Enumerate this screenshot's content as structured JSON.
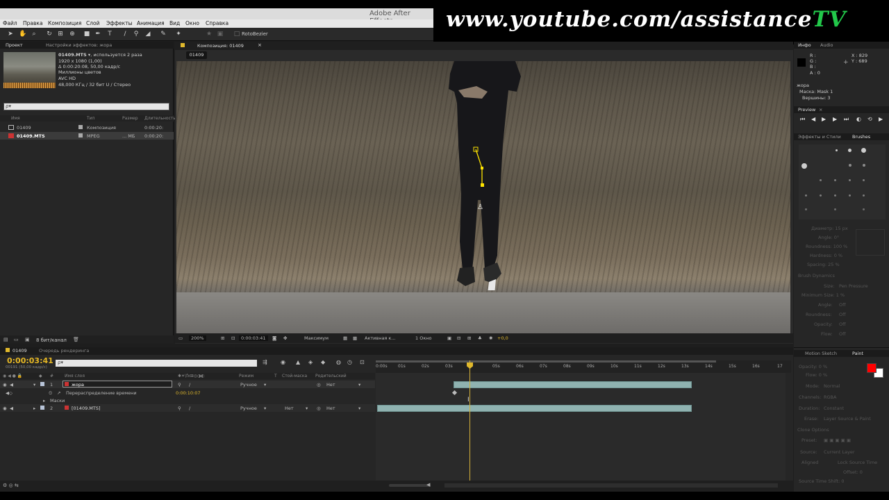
{
  "window": {
    "title": "Adobe After Effects -"
  },
  "banner": {
    "url_main": "www.youtube.com/assistance",
    "url_tv": "TV"
  },
  "menu": [
    "Файл",
    "Правка",
    "Композиция",
    "Слой",
    "Эффекты",
    "Анимация",
    "Вид",
    "Окно",
    "Справка"
  ],
  "toolbar": {
    "rotobezier_label": "RotoBezier"
  },
  "project": {
    "tab_project": "Проект",
    "tab_effects": "Настройки эффектов: жора",
    "footage_name": "01409.MTS ▾",
    "footage_used": ", используется 2 раза",
    "footage_res": "1920 x 1080 (1,00)",
    "footage_dur": "Δ 0:00:20:08, 50,00 кадр/с",
    "footage_colors": "Миллионы цветов",
    "footage_codec": "AVC HD",
    "footage_audio": "48,000 КГц / 32 бит U / Стерео",
    "search_placeholder": "ρ▾",
    "col_name": "Имя",
    "col_type": "Тип",
    "col_size": "Размер",
    "col_duration": "Длительность",
    "items": [
      {
        "name": "01409",
        "type": "Композиция",
        "size": "",
        "duration": "0:00:20:"
      },
      {
        "name": "01409.MTS",
        "type": "MPEG",
        "size": "... МБ",
        "duration": "0:00:20:"
      }
    ],
    "footer_bits": "8 бит/канал"
  },
  "composition": {
    "tab": "Композиция: 01409",
    "breadcrumb": "01409",
    "zoom": "200%",
    "timecode": "0:00:03:41",
    "quality": "Максимум",
    "camera": "Активная к...",
    "views": "1 Окно",
    "exposure": "+0,0"
  },
  "info_panel": {
    "tab_info": "Инфо",
    "tab_audio": "Audio",
    "r": "R :",
    "g": "G :",
    "b": "B :",
    "a": "A : 0",
    "x": "X : 829",
    "y": "Y : 689",
    "layer": "жора",
    "mask": "Маска: Mask 1",
    "vertices": "Вершины: 3"
  },
  "preview_panel": {
    "tab": "Preview"
  },
  "effects_panel": {
    "tab_effects": "Эффекты и Стили",
    "tab_brushes": "Brushes",
    "diameter": "Диаметр: 15 px",
    "angle": "Angle: 0°",
    "roundness": "Roundness: 100 %",
    "hardness": "Hardness: 0 %",
    "spacing": "Spacing: 25 %",
    "dynamics": "Brush Dynamics",
    "size": "Size:",
    "size_val": "Pen Pressure",
    "min_size": "Minimum Size: 1 %",
    "angle2": "Angle:",
    "angle2_val": "Off",
    "roundness2": "Roundness:",
    "roundness2_val": "Off",
    "opacity": "Opacity:",
    "opacity_val": "Off",
    "flow": "Flow:",
    "flow_val": "Off"
  },
  "paint_panel": {
    "tab_motion": "Motion Sketch",
    "tab_paint": "Paint",
    "opacity": "Opacity: 0 %",
    "flow": "Flow: 0 %",
    "mode": "Mode:",
    "mode_val": "Normal",
    "channels": "Channels:",
    "channels_val": "RGBA",
    "duration": "Duration:",
    "duration_val": "Constant",
    "erase": "Erase:",
    "erase_val": "Layer Source & Paint",
    "clone_options": "Clone Options",
    "preset": "Preset:",
    "source": "Source:",
    "source_val": "Current Layer",
    "aligned": "Aligned",
    "lock_source": "Lock Source Time",
    "offset": "Offset: 0",
    "source_time": "Source Time Shift: 0",
    "fg_color": "#ff0000",
    "bg_color": "#ffffff"
  },
  "timeline": {
    "tab_comp": "01409",
    "tab_render": "Очередь рендеринга",
    "timecode": "0:00:03:41",
    "timecode_sub": "00191 (50,00 кадр/с)",
    "search_placeholder": "ρ▾",
    "col_num": "#",
    "col_name": "Имя слоя",
    "col_mode": "Режим",
    "col_t": "T",
    "col_trkmat": "Стой-маска",
    "col_parent": "Родительский",
    "layers": [
      {
        "num": "1",
        "name": "жора",
        "mode": "Ручное",
        "trkmat": "",
        "parent": "Нет"
      },
      {
        "num": "2",
        "name": "[01409.MTS]",
        "mode": "Ручное",
        "trkmat": "Нет",
        "parent": "Нет"
      }
    ],
    "timeremap_label": "Перераспределение времени",
    "timeremap_value": "0:00:10:07",
    "masks_label": "Маски",
    "ruler_ticks": [
      "0:00s",
      "01s",
      "02s",
      "03s",
      "",
      "05s",
      "06s",
      "07s",
      "08s",
      "09s",
      "10s",
      "11s",
      "12s",
      "13s",
      "14s",
      "15s",
      "16s",
      "17"
    ]
  }
}
